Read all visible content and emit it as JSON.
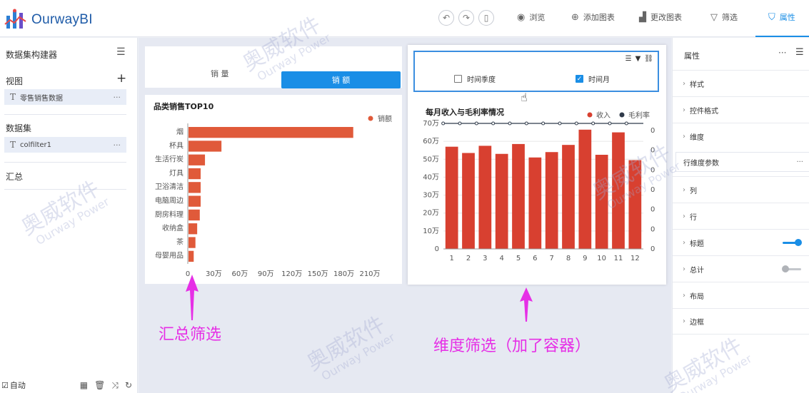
{
  "app": {
    "brand": "OurwayBI"
  },
  "toolbar": {
    "undo_icon": "undo-icon",
    "redo_icon": "redo-icon",
    "mobile_icon": "mobile-icon",
    "items": [
      {
        "label": "浏览",
        "icon": "eye-icon"
      },
      {
        "label": "添加图表",
        "icon": "plus-circle-icon"
      },
      {
        "label": "更改图表",
        "icon": "bar-chart-icon"
      },
      {
        "label": "筛选",
        "icon": "filter-icon"
      },
      {
        "label": "属性",
        "icon": "shirt-icon"
      }
    ],
    "active": "属性"
  },
  "left_panel": {
    "title": "数据集构建器",
    "view_label": "视图",
    "view_item": "零售销售数据",
    "dataset_label": "数据集",
    "dataset_item": "colfilter1",
    "summary_label": "汇总",
    "auto_label": "自动"
  },
  "toggle": {
    "left": "销 量",
    "right": "销 额"
  },
  "bar_chart_title": "品类销售TOP10",
  "line_chart_title": "每月收入与毛利率情况",
  "filter_box": {
    "options": [
      {
        "label": "时间季度",
        "checked": false
      },
      {
        "label": "时间月",
        "checked": true
      }
    ]
  },
  "annotations": {
    "left": "汇总筛选",
    "right": "维度筛选（加了容器）"
  },
  "right_panel": {
    "title": "属性",
    "rows": [
      "样式",
      "控件格式",
      "维度",
      "列",
      "行",
      "标题",
      "总计",
      "布局",
      "边框"
    ],
    "sub_item": "行维度参数",
    "title_switch_on": true,
    "total_switch_on": false
  },
  "watermark": {
    "cn": "奥威软件",
    "en": "Ourway Power"
  },
  "chart_data": [
    {
      "type": "bar",
      "orientation": "horizontal",
      "title": "品类销售TOP10",
      "legend": [
        "销额"
      ],
      "legend_position": "top-right",
      "categories": [
        "烟",
        "杯具",
        "生活行炭",
        "灯具",
        "卫浴清洁",
        "电脑周边",
        "厨房料理",
        "收纳盒",
        "茶",
        "母婴用品"
      ],
      "values": [
        1900000,
        380000,
        190000,
        140000,
        140000,
        140000,
        130000,
        100000,
        80000,
        60000
      ],
      "x_ticks": [
        "0",
        "30万",
        "60万",
        "90万",
        "120万",
        "150万",
        "180万",
        "210万"
      ],
      "xlim": [
        0,
        2100000
      ],
      "color": "#e05a3a"
    },
    {
      "type": "bar",
      "title": "每月收入与毛利率情况",
      "legend": [
        "收入",
        "毛利率"
      ],
      "legend_position": "top-right",
      "categories": [
        "1",
        "2",
        "3",
        "4",
        "5",
        "6",
        "7",
        "8",
        "9",
        "10",
        "11",
        "12"
      ],
      "series": [
        {
          "name": "收入",
          "type": "bar",
          "values": [
            570000,
            535000,
            575000,
            530000,
            585000,
            510000,
            540000,
            580000,
            665000,
            525000,
            650000,
            495000
          ],
          "color": "#d84030"
        },
        {
          "name": "毛利率",
          "type": "line",
          "values": [
            0,
            0,
            0,
            0,
            0,
            0,
            0,
            0,
            0,
            0,
            0,
            0
          ],
          "color": "#2f3a4a"
        }
      ],
      "y_ticks": [
        "0",
        "10万",
        "20万",
        "30万",
        "40万",
        "50万",
        "60万",
        "70万"
      ],
      "ylim": [
        0,
        700000
      ],
      "y2_ticks": [
        "0",
        "0",
        "0",
        "0",
        "0",
        "0",
        "0"
      ]
    }
  ]
}
